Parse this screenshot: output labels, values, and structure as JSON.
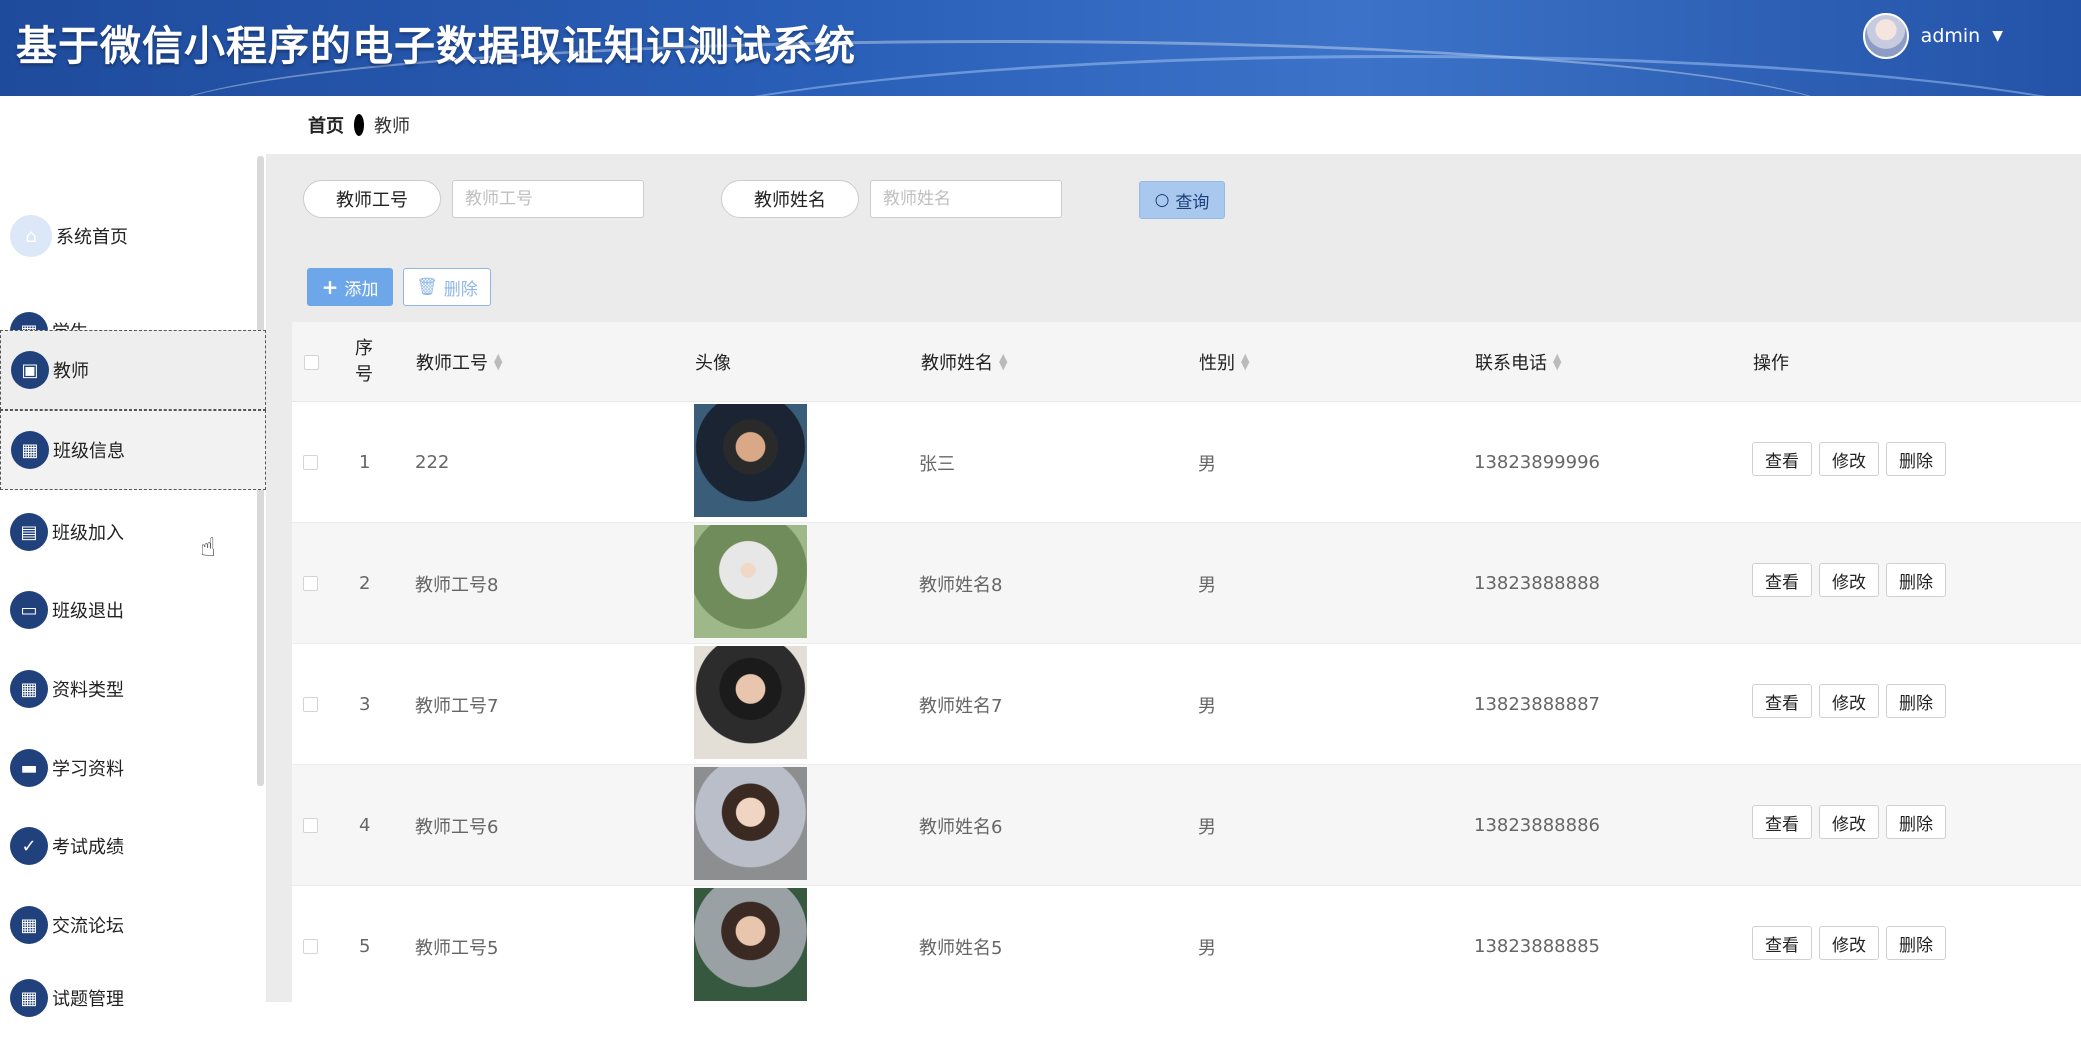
{
  "header": {
    "title": "基于微信小程序的电子数据取证知识测试系统",
    "username": "admin",
    "caret": "▼"
  },
  "sidebar": {
    "items": [
      {
        "label": "系统首页",
        "icon": "⌂",
        "icon_name": "home-icon"
      },
      {
        "label": "学生",
        "icon": "▦",
        "icon_name": "grid-icon"
      },
      {
        "label": "教师",
        "icon": "▣",
        "icon_name": "briefcase-icon"
      },
      {
        "label": "班级信息",
        "icon": "▦",
        "icon_name": "grid-icon"
      },
      {
        "label": "班级加入",
        "icon": "▤",
        "icon_name": "clipboard-icon"
      },
      {
        "label": "班级退出",
        "icon": "▭",
        "icon_name": "monitor-icon"
      },
      {
        "label": "资料类型",
        "icon": "▦",
        "icon_name": "grid-icon"
      },
      {
        "label": "学习资料",
        "icon": "▬",
        "icon_name": "chat-icon"
      },
      {
        "label": "考试成绩",
        "icon": "✓",
        "icon_name": "clipboard-check-icon"
      },
      {
        "label": "交流论坛",
        "icon": "▦",
        "icon_name": "grid-icon"
      },
      {
        "label": "试题管理",
        "icon": "▦",
        "icon_name": "grid-icon"
      }
    ]
  },
  "breadcrumb": {
    "home": "首页",
    "current": "教师"
  },
  "search": {
    "field1_label": "教师工号",
    "field1_placeholder": "教师工号",
    "field2_label": "教师姓名",
    "field2_placeholder": "教师姓名",
    "query_label": "查询"
  },
  "actions": {
    "add_label": "添加",
    "delete_label": "删除"
  },
  "table": {
    "headers": {
      "seq": [
        "序",
        "号"
      ],
      "teacher_id": "教师工号",
      "avatar": "头像",
      "teacher_name": "教师姓名",
      "gender": "性别",
      "phone": "联系电话",
      "operations": "操作"
    },
    "op_labels": {
      "view": "查看",
      "edit": "修改",
      "delete": "删除"
    },
    "rows": [
      {
        "seq": "1",
        "teacher_id": "222",
        "teacher_name": "张三",
        "gender": "男",
        "phone": "13823899996"
      },
      {
        "seq": "2",
        "teacher_id": "教师工号8",
        "teacher_name": "教师姓名8",
        "gender": "男",
        "phone": "13823888888"
      },
      {
        "seq": "3",
        "teacher_id": "教师工号7",
        "teacher_name": "教师姓名7",
        "gender": "男",
        "phone": "13823888887"
      },
      {
        "seq": "4",
        "teacher_id": "教师工号6",
        "teacher_name": "教师姓名6",
        "gender": "男",
        "phone": "13823888886"
      },
      {
        "seq": "5",
        "teacher_id": "教师工号5",
        "teacher_name": "教师姓名5",
        "gender": "男",
        "phone": "13823888885"
      }
    ]
  },
  "colors": {
    "header_blue": "#2a5fb8",
    "menu_icon": "#21417c",
    "primary": "#6ea6ea"
  }
}
